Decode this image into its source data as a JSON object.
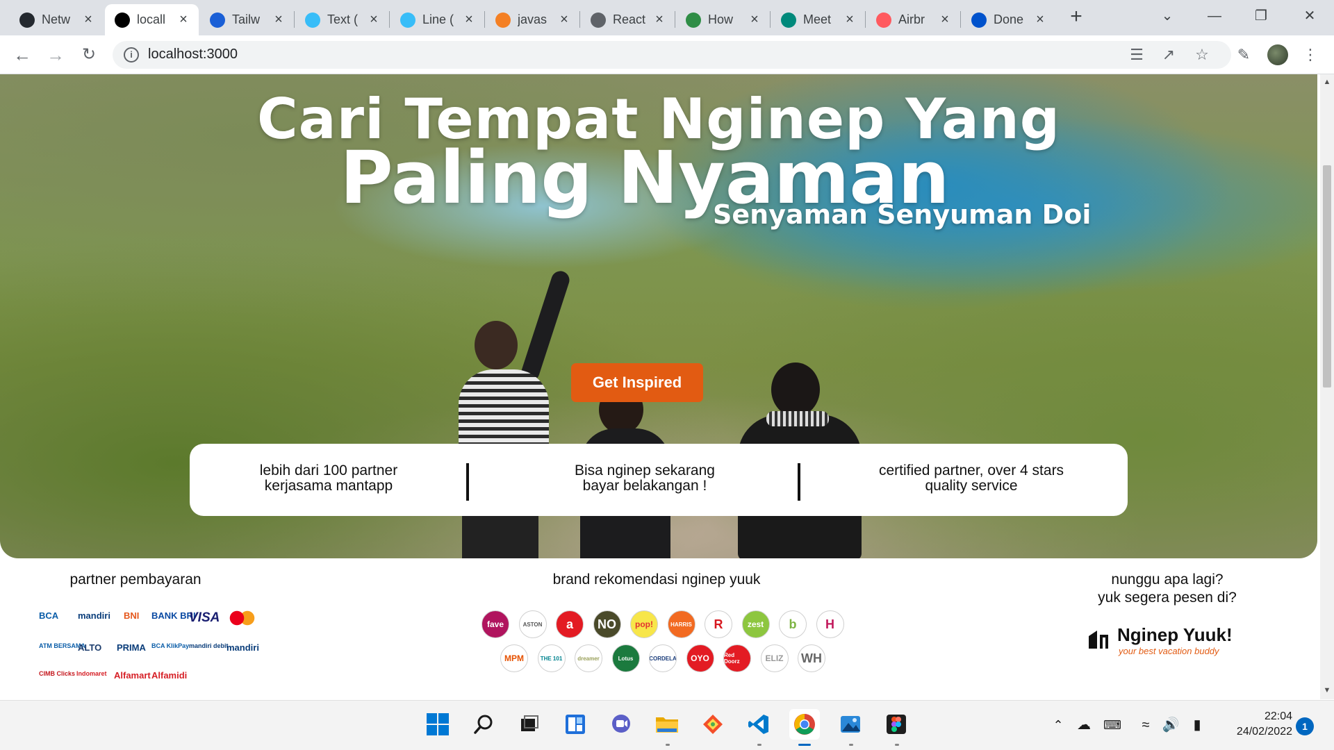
{
  "tabs": [
    {
      "title": "Netw",
      "icon": "github-icon",
      "color": "#24292f"
    },
    {
      "title": "locall",
      "icon": "triangle-logo-icon",
      "color": "#000000",
      "active": true
    },
    {
      "title": "Tailw",
      "icon": "tailwind-icon",
      "color": "#1a5fd6"
    },
    {
      "title": "Text (",
      "icon": "tailwind-wave-icon",
      "color": "#38bdf8"
    },
    {
      "title": "Line (",
      "icon": "tailwind-wave-icon",
      "color": "#38bdf8"
    },
    {
      "title": "javas",
      "icon": "stackoverflow-icon",
      "color": "#f48024"
    },
    {
      "title": "React",
      "icon": "globe-icon",
      "color": "#5f6368"
    },
    {
      "title": "How",
      "icon": "geeksforgeeks-icon",
      "color": "#2f8d46"
    },
    {
      "title": "Meet",
      "icon": "meet-icon",
      "color": "#00897b"
    },
    {
      "title": "Airbr",
      "icon": "airbnb-icon",
      "color": "#ff5a5f"
    },
    {
      "title": "Done",
      "icon": "trello-icon",
      "color": "#0052cc"
    }
  ],
  "toolbar": {
    "url": "localhost:3000"
  },
  "hero": {
    "title_line1": "Cari Tempat Nginep Yang",
    "title_line2": "Paling Nyaman",
    "subtitle": "Senyaman Senyuman Doi",
    "cta_label": "Get Inspired",
    "features": [
      {
        "line1": "lebih dari 100 partner",
        "line2": "kerjasama mantapp"
      },
      {
        "line1": "Bisa nginep sekarang",
        "line2": "bayar belakangan !"
      },
      {
        "line1": "certified partner, over 4 stars",
        "line2": "quality service"
      }
    ]
  },
  "payments": {
    "title": "partner pembayaran",
    "logos": [
      {
        "label": "BCA",
        "color": "#0a5da8"
      },
      {
        "label": "mandiri",
        "color": "#0a3d7a"
      },
      {
        "label": "BNI",
        "color": "#e5581d"
      },
      {
        "label": "BANK BRI",
        "color": "#0a4aa3"
      },
      {
        "label": "VISA",
        "color": "#1a1f71"
      },
      {
        "label": "mastercard",
        "color": "#eb001b"
      },
      {
        "label": "ATM BERSAMA",
        "color": "#0a5da8"
      },
      {
        "label": "ALTO",
        "color": "#1c3c6c"
      },
      {
        "label": "PRIMA",
        "color": "#0a3d7a"
      },
      {
        "label": "BCA KlikPay",
        "color": "#0a5da8"
      },
      {
        "label": "mandiri debit",
        "color": "#0a3d7a"
      },
      {
        "label": "mandiri",
        "color": "#0a3d7a"
      },
      {
        "label": "CIMB Clicks",
        "color": "#c4161c"
      },
      {
        "label": "Indomaret",
        "color": "#d61f26"
      },
      {
        "label": "Alfamart",
        "color": "#d61f26"
      },
      {
        "label": "Alfamidi",
        "color": "#d61f26"
      }
    ]
  },
  "brands": {
    "title": "brand rekomendasi nginep yuuk",
    "row1": [
      {
        "label": "fave",
        "bg": "#b0145e",
        "fg": "#ffffff"
      },
      {
        "label": "ASTON",
        "bg": "#ffffff",
        "fg": "#555555"
      },
      {
        "label": "a",
        "bg": "#e31b23",
        "fg": "#ffffff"
      },
      {
        "label": "NO",
        "bg": "#4a4a2a",
        "fg": "#ffffff"
      },
      {
        "label": "pop!",
        "bg": "#f7e64a",
        "fg": "#e3342f"
      },
      {
        "label": "HARRIS",
        "bg": "#f26a21",
        "fg": "#ffffff"
      },
      {
        "label": "R",
        "bg": "#ffffff",
        "fg": "#d71920"
      },
      {
        "label": "zest",
        "bg": "#8dc63f",
        "fg": "#ffffff"
      },
      {
        "label": "b",
        "bg": "#ffffff",
        "fg": "#7cb342"
      },
      {
        "label": "H",
        "bg": "#ffffff",
        "fg": "#c2185b"
      }
    ],
    "row2": [
      {
        "label": "MPM",
        "bg": "#ffffff",
        "fg": "#e65100"
      },
      {
        "label": "THE 101",
        "bg": "#ffffff",
        "fg": "#00838f"
      },
      {
        "label": "dreamer",
        "bg": "#ffffff",
        "fg": "#9aa05a"
      },
      {
        "label": "Lotus",
        "bg": "#1b7a3e",
        "fg": "#ffffff"
      },
      {
        "label": "CORDELA",
        "bg": "#ffffff",
        "fg": "#1a3c7a"
      },
      {
        "label": "OYO",
        "bg": "#e31b23",
        "fg": "#ffffff"
      },
      {
        "label": "Red Doorz",
        "bg": "#e31b23",
        "fg": "#ffffff"
      },
      {
        "label": "ELIZ",
        "bg": "#ffffff",
        "fg": "#999999"
      },
      {
        "label": "WH",
        "bg": "#ffffff",
        "fg": "#666666"
      }
    ]
  },
  "cta_side": {
    "line1": "nunggu apa lagi?",
    "line2": "yuk segera pesen di?",
    "logo_name": "Nginep Yuuk!",
    "logo_tagline": "your best vacation buddy"
  },
  "taskbar": {
    "time": "22:04",
    "date": "24/02/2022",
    "notifications": "1"
  },
  "colors": {
    "accent": "#e25b12",
    "taskbar_accent": "#0067c0"
  }
}
